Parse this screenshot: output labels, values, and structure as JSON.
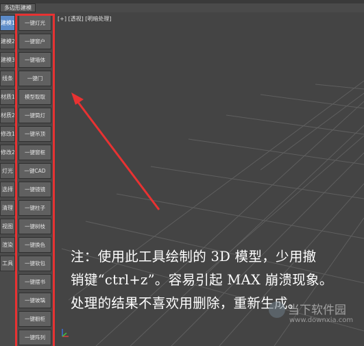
{
  "panel_tab": "多边形建模",
  "viewport_label": "[+] [透视] [明暗处理]",
  "categories": [
    "建模1",
    "建模2",
    "建模3",
    "线条",
    "材质1",
    "材质2",
    "修改1",
    "修改2",
    "灯光",
    "选择",
    "清理",
    "视图",
    "渲染",
    "工具"
  ],
  "buttons": [
    "一键灯光",
    "一键窗户",
    "一键墙体",
    "一键门",
    "模型取取",
    "一键筒灯",
    "一键吊顶",
    "一键窗框",
    "一键CAD",
    "一键镜镜",
    "一键柱子",
    "一键树枝",
    "一键换色",
    "一键软包",
    "一键摆书",
    "一键玻璃",
    "一键橱柜",
    "一键阵列"
  ],
  "annotation": {
    "line1": "注：使用此工具绘制的 3D 模型，少用撤",
    "line2": "销键“ctrl+z”。容易引起 MAX 崩溃现象。",
    "line3": "处理的结果不喜欢用删除，重新生成。"
  },
  "watermark": {
    "name": "当下软件园",
    "url": "www.downxia.com"
  },
  "colors": {
    "highlight": "#e83232",
    "active_tab": "#5c8bc8"
  }
}
